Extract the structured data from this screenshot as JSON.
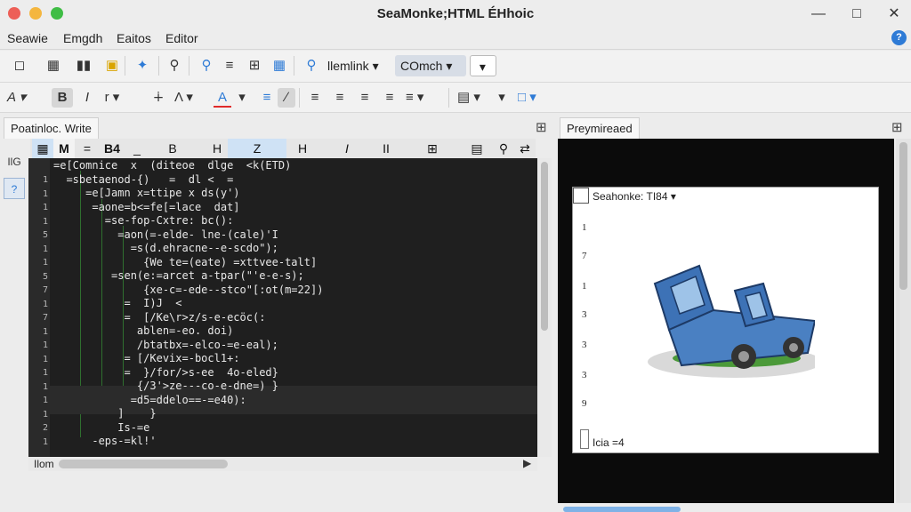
{
  "window": {
    "title": "SeaMonke​;HTML ÉHhoic"
  },
  "menu": [
    "Seawie",
    "Emgdh",
    "Eaitos",
    "Editor"
  ],
  "toolbar1": {
    "link_field": "llemlink",
    "style_field": "COmch"
  },
  "editor": {
    "tab_label": "Poatinloc. Write",
    "left_label": "IlG",
    "status_label": "Ilom",
    "format_buttons": [
      "M",
      "=",
      "B4",
      "_",
      "B",
      "H",
      "Z",
      "H",
      "I",
      "II"
    ],
    "line_numbers": [
      "1",
      "1",
      "1",
      "1",
      "5",
      "1",
      "1",
      "5",
      "7",
      "1",
      "7",
      "1",
      "1",
      "1",
      "1",
      "1",
      "1",
      "1",
      "2",
      "1"
    ],
    "code_lines": [
      "=e[Comnice  x  (diteoe  dlge  <k(ETD)",
      "  =sbetaenod-{)   =  dl <  =",
      "     =e[Jamn x=ttipe x ds(y')",
      "      =aone=b<=fe[=lace  dat]",
      "        =se-fop-Cxtre: bc():",
      "          =aon(=-elde- lne-(cale)'I",
      "            =s(d.ehracne--e-scdo\");",
      "              {We te=(eate) =xttvee-talt]",
      "         =sen(e:=arcet a-tpar(\"'e-e-s);",
      "              {xe-c=-ede--stco\"[:ot(m=22])",
      "           =  I)J  <",
      "           =  [/Ke\\r>z/s-e-ecöc(:",
      "             ablen=-eo. doi)",
      "             /btatbx=-elco-=e-eal);",
      "           = [/Kevix=-bocl1+:",
      "           =  }/for/>s-ee  4o-eled}",
      "             {/3'>ze---co-e-dne=) }",
      "            =d5=ddelo==-=e40):",
      "          ]    }",
      "          Is-=e",
      "      -eps-=kl!'",
      "  "
    ]
  },
  "preview": {
    "tab_label": "Preymireaed",
    "page_header": "Seahonke: TI84",
    "page_numbers": [
      "1",
      "7",
      "1",
      "3",
      "3",
      "3",
      "9"
    ],
    "page_footer": "Icia  =4"
  },
  "colors": {
    "accent": "#2e7bd6",
    "code_bg": "#1f1f1f",
    "preview_bg": "#0b0b0b"
  }
}
